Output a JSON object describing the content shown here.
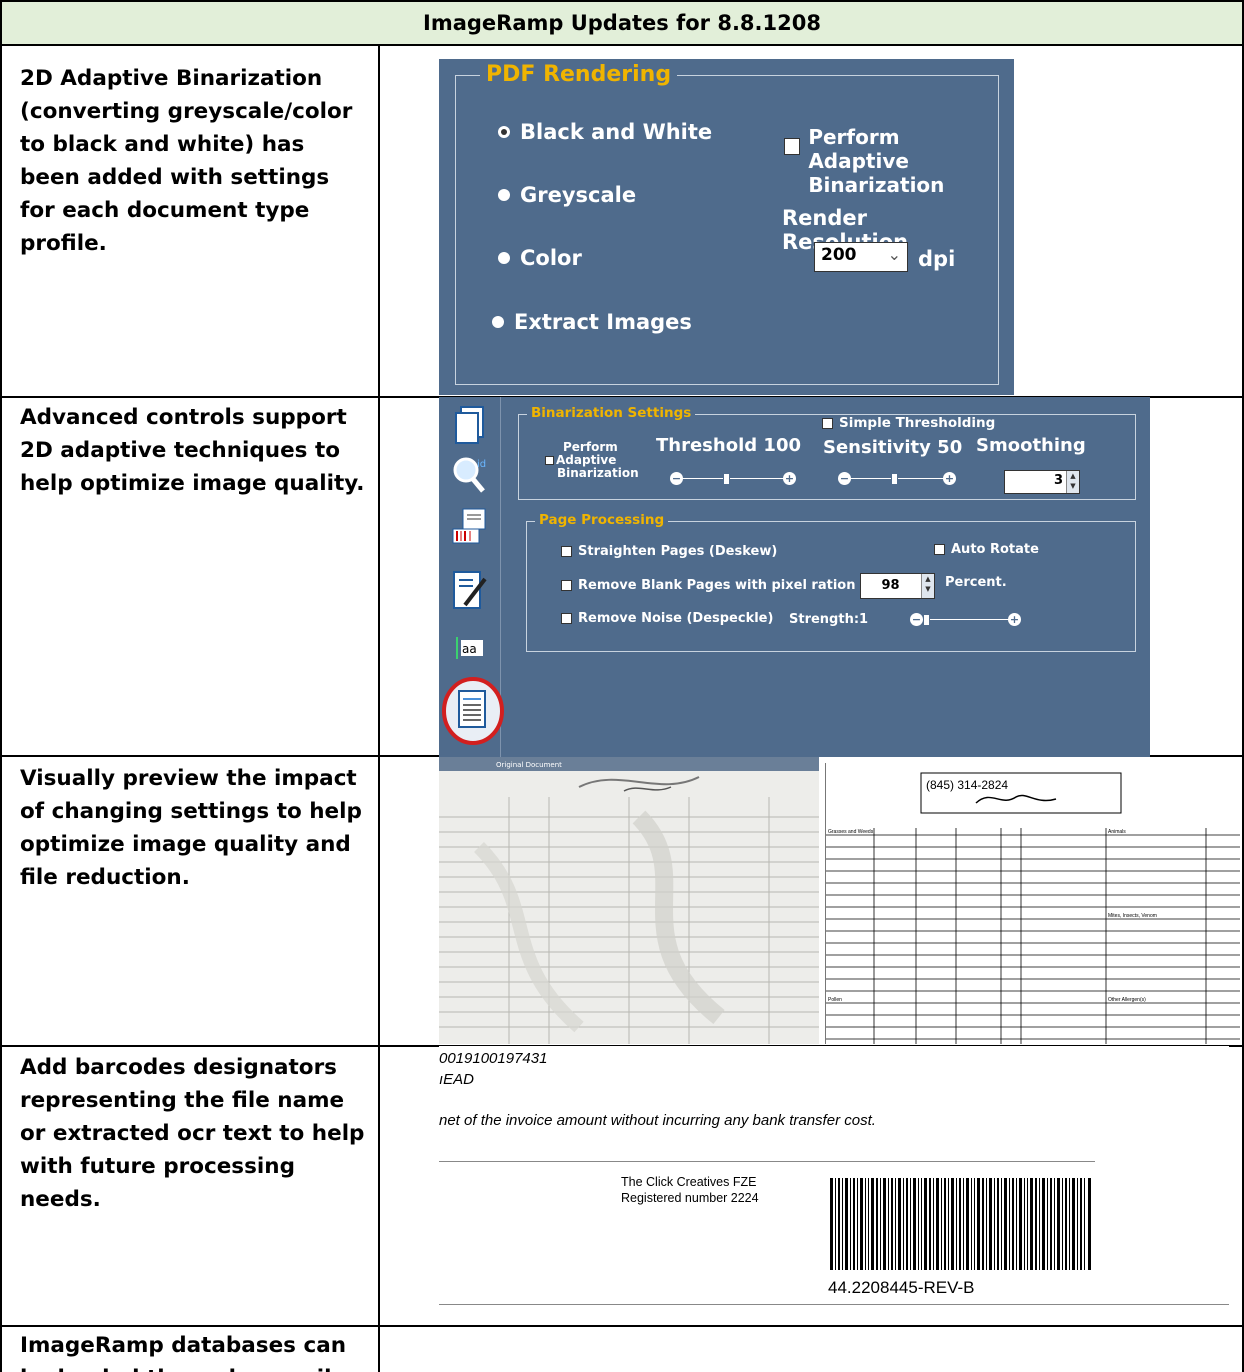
{
  "header": {
    "title": "ImageRamp Updates for 8.8.1208"
  },
  "rows": [
    {
      "description": "2D Adaptive Binarization (converting greyscale/color to black and white) has been added with settings for each document type profile."
    },
    {
      "description": "Advanced controls support 2D adaptive techniques to help optimize image quality."
    },
    {
      "description": "Visually preview the impact of changing settings to help optimize image quality and file reduction."
    },
    {
      "description": "Add barcodes designators representing the file name or extracted ocr text to help with future processing needs."
    },
    {
      "description": "ImageRamp databases can be loaded through compiler"
    }
  ],
  "pdf_rendering": {
    "group_title": "PDF Rendering",
    "options": [
      "Black and White",
      "Greyscale",
      "Color",
      "Extract Images"
    ],
    "selected_option": "Black and White",
    "adaptive_checkbox": {
      "line1": "Perform Adaptive",
      "line2": "Binarization",
      "checked": false
    },
    "resolution_label": "Render Resolution",
    "resolution_value": "200",
    "resolution_unit": "dpi"
  },
  "binarization": {
    "group_title": "Binarization Settings",
    "simple_thresholding": "Simple Thresholding",
    "perform_adaptive": [
      "Perform",
      "Adaptive",
      "Binarization"
    ],
    "threshold_label": "Threshold",
    "threshold_value": "100",
    "sensitivity_label": "Sensitivity",
    "sensitivity_value": "50",
    "smoothing_label": "Smoothing",
    "smoothing_value": "3"
  },
  "page_processing": {
    "group_title": "Page Processing",
    "straighten": "Straighten Pages (Deskew)",
    "auto_rotate": "Auto Rotate",
    "remove_blank": "Remove Blank Pages with pixel ration <",
    "blank_value": "98",
    "percent": "Percent.",
    "remove_noise": "Remove Noise (Despeckle)",
    "strength": "Strength:1"
  },
  "preview": {
    "label": "Original Document"
  },
  "invoice": {
    "line1": "0019100197431",
    "line2": "ıEAD",
    "line3": "net of the invoice amount without incurring any bank transfer cost.",
    "company_line1": "The Click Creatives FZE",
    "company_line2": "Registered number 2224",
    "barcode_text": "44.2208445-REV-B"
  },
  "colors": {
    "header_bg": "#e2efd9",
    "panel_bg": "#4f6b8c",
    "panel_accent": "#f0b400"
  }
}
